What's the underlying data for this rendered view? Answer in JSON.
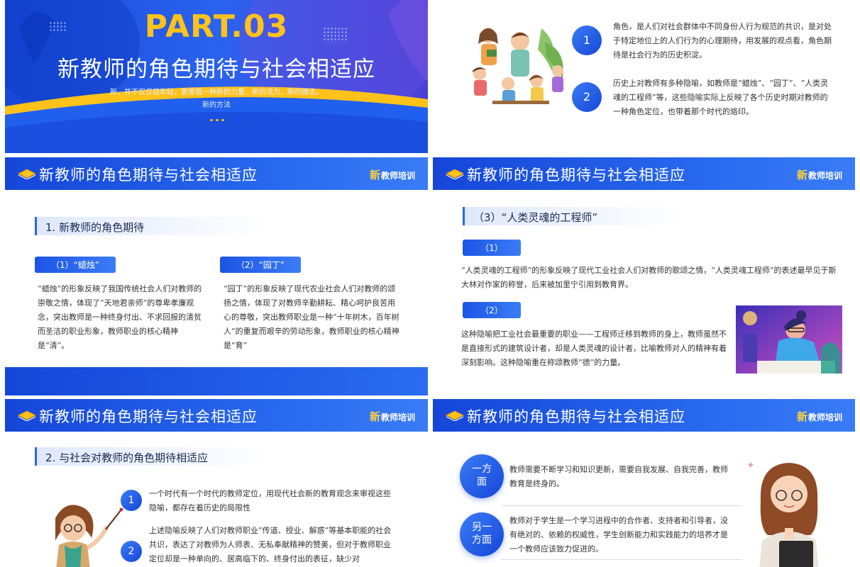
{
  "colors": {
    "primary": "#1f5ae8",
    "accent": "#ffc21a",
    "text": "#333333"
  },
  "cover": {
    "part": "PART.03",
    "title": "新教师的角色期待与社会相适应",
    "subtitle_line1": "新，并不仅仅指年轻，更是指一种新的力量，新的活力，新的理念，",
    "subtitle_line2": "新的方法"
  },
  "header": {
    "title": "新教师的角色期待与社会相适应",
    "logo_char": "新",
    "logo_text": "教师培训"
  },
  "role_def": {
    "items": [
      {
        "num": "1",
        "text": "角色，是人们对社会群体中不同身份人行为规范的共识，是对处于特定地位上的人们行为的心理期待，用发展的观点看，角色期待是社会行为的历史积淀。"
      },
      {
        "num": "2",
        "text": "历史上对教师有多种隐喻，如教师是“蜡烛”、“园丁”、“人类灵魂的工程师”等，这些隐喻实际上反映了各个历史时期对教师的一种角色定位，也带着那个时代的烙印。"
      }
    ]
  },
  "expectations": {
    "section": "1. 新教师的角色期待",
    "candle": {
      "tag": "（1）“蜡烛”",
      "text": "“蜡烛”的形象反映了我国传统社会人们对教师的崇敬之情，体现了“天地君亲师”的尊卑孝廉观念，突出教师是一种终身付出、不求回报的清贫而圣洁的职业形象，教师职业的核心精神是“清”。"
    },
    "gardener": {
      "tag": "（2）“园丁”",
      "text": "“园丁”的形象反映了现代农业社会人们对教师的颂扬之情，体现了对教师辛勤耕耘、精心呵护良苦用心的尊敬，突出教师职业是一种“十年树木，百年树人”的重复而艰辛的劳动形象，教师职业的核心精神是“育”"
    }
  },
  "engineer": {
    "section": "（3）“人类灵魂的工程师”",
    "tag1": "（1）",
    "text1": "“人类灵魂的工程师”的形象反映了现代工业社会人们对教师的歌颂之情，“人类灵魂工程师”的表述最早见于斯大林对作家的称誉，后来被加里宁引用到教育界。",
    "tag2": "（2）",
    "text2": "这种隐喻把工业社会最重要的职业——工程师迁移到教师的身上，教师虽然不是直接形式的建筑设计者，却是人类灵魂的设计者，比喻教师对人的精神有着深刻影响。这种隐喻重在称颂教师“德”的力量。"
  },
  "adapt": {
    "section": "2. 与社会对教师的角色期待相适应",
    "items": [
      {
        "num": "1",
        "text": "一个时代有一个时代的教师定位，用现代社会新的教育观念来审视这些隐喻，都存在着历史的局限性"
      },
      {
        "num": "2",
        "text": "上述隐喻反映了人们对教师职业“传道、授业、解惑”等基本职能的社会共识，表达了对教师为人师表、无私奉献精神的赞美，但对于教师职业定位却是一种单向的、居高临下的、终身付出的表征，缺少对"
      }
    ]
  },
  "aspects": {
    "one_label_1": "一方",
    "one_label_2": "面",
    "one_text": "教师需要不断学习和知识更新，需要自我发展、自我完善，教师教育是终身的。",
    "two_label_1": "另一",
    "two_label_2": "方面",
    "two_text": "教师对于学生是一个学习进程中的合作者、支持者和引导者，没有绝对的、依赖的权威性，学生创新能力和实践能力的培养才是一个教师应该致力促进的。"
  }
}
